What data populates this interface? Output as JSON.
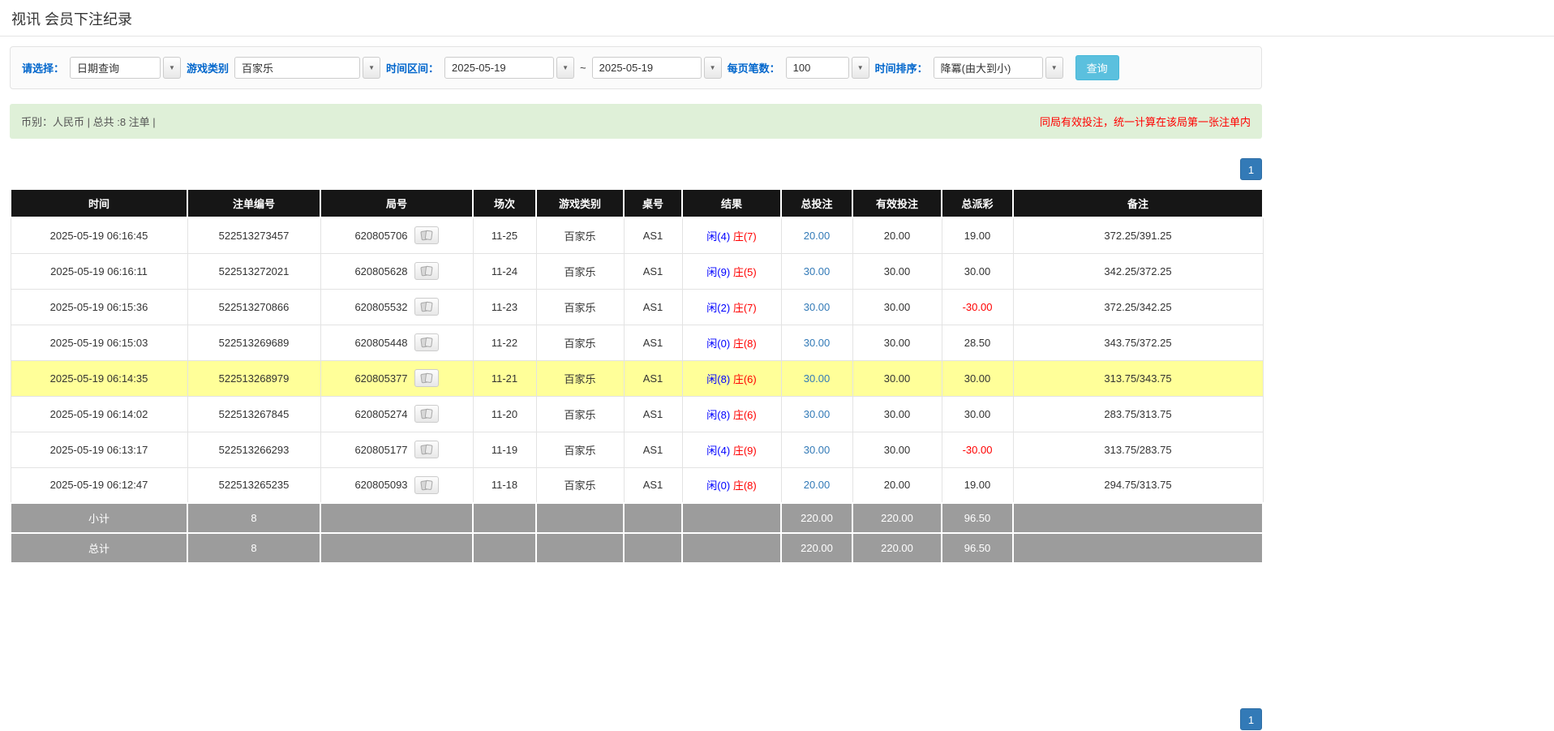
{
  "page": {
    "title": "视讯 会员下注纪录"
  },
  "filters": {
    "select_label": "请选择：",
    "select_value": "日期查询",
    "game_label": "游戏类别",
    "game_value": "百家乐",
    "range_label": "时间区间：",
    "range_from": "2025-05-19",
    "range_tilde": "~",
    "range_to": "2025-05-19",
    "per_page_label": "每页笔数：",
    "per_page_value": "100",
    "sort_label": "时间排序：",
    "sort_value": "降冪(由大到小)",
    "search_button": "查询"
  },
  "info_bar": {
    "summary": "币别：人民币 | 总共 :8 注单 |",
    "notice": "同局有效投注，统一计算在该局第一张注单内"
  },
  "pagination": {
    "page": "1"
  },
  "table": {
    "headers": [
      "时间",
      "注单编号",
      "局号",
      "场次",
      "游戏类别",
      "桌号",
      "结果",
      "总投注",
      "有效投注",
      "总派彩",
      "备注"
    ],
    "rows": [
      {
        "time": "2025-05-19 06:16:45",
        "bet_id": "522513273457",
        "round_id": "620805706",
        "session": "11-25",
        "game": "百家乐",
        "table_no": "AS1",
        "result_player": "闲(4)",
        "result_banker": "庄(7)",
        "total_bet": "20.00",
        "valid_bet": "20.00",
        "payout": "19.00",
        "payout_negative": false,
        "remark": "372.25/391.25",
        "highlighted": false
      },
      {
        "time": "2025-05-19 06:16:11",
        "bet_id": "522513272021",
        "round_id": "620805628",
        "session": "11-24",
        "game": "百家乐",
        "table_no": "AS1",
        "result_player": "闲(9)",
        "result_banker": "庄(5)",
        "total_bet": "30.00",
        "valid_bet": "30.00",
        "payout": "30.00",
        "payout_negative": false,
        "remark": "342.25/372.25",
        "highlighted": false
      },
      {
        "time": "2025-05-19 06:15:36",
        "bet_id": "522513270866",
        "round_id": "620805532",
        "session": "11-23",
        "game": "百家乐",
        "table_no": "AS1",
        "result_player": "闲(2)",
        "result_banker": "庄(7)",
        "total_bet": "30.00",
        "valid_bet": "30.00",
        "payout": "-30.00",
        "payout_negative": true,
        "remark": "372.25/342.25",
        "highlighted": false
      },
      {
        "time": "2025-05-19 06:15:03",
        "bet_id": "522513269689",
        "round_id": "620805448",
        "session": "11-22",
        "game": "百家乐",
        "table_no": "AS1",
        "result_player": "闲(0)",
        "result_banker": "庄(8)",
        "total_bet": "30.00",
        "valid_bet": "30.00",
        "payout": "28.50",
        "payout_negative": false,
        "remark": "343.75/372.25",
        "highlighted": false
      },
      {
        "time": "2025-05-19 06:14:35",
        "bet_id": "522513268979",
        "round_id": "620805377",
        "session": "11-21",
        "game": "百家乐",
        "table_no": "AS1",
        "result_player": "闲(8)",
        "result_banker": "庄(6)",
        "total_bet": "30.00",
        "valid_bet": "30.00",
        "payout": "30.00",
        "payout_negative": false,
        "remark": "313.75/343.75",
        "highlighted": true
      },
      {
        "time": "2025-05-19 06:14:02",
        "bet_id": "522513267845",
        "round_id": "620805274",
        "session": "11-20",
        "game": "百家乐",
        "table_no": "AS1",
        "result_player": "闲(8)",
        "result_banker": "庄(6)",
        "total_bet": "30.00",
        "valid_bet": "30.00",
        "payout": "30.00",
        "payout_negative": false,
        "remark": "283.75/313.75",
        "highlighted": false
      },
      {
        "time": "2025-05-19 06:13:17",
        "bet_id": "522513266293",
        "round_id": "620805177",
        "session": "11-19",
        "game": "百家乐",
        "table_no": "AS1",
        "result_player": "闲(4)",
        "result_banker": "庄(9)",
        "total_bet": "30.00",
        "valid_bet": "30.00",
        "payout": "-30.00",
        "payout_negative": true,
        "remark": "313.75/283.75",
        "highlighted": false
      },
      {
        "time": "2025-05-19 06:12:47",
        "bet_id": "522513265235",
        "round_id": "620805093",
        "session": "11-18",
        "game": "百家乐",
        "table_no": "AS1",
        "result_player": "闲(0)",
        "result_banker": "庄(8)",
        "total_bet": "20.00",
        "valid_bet": "20.00",
        "payout": "19.00",
        "payout_negative": false,
        "remark": "294.75/313.75",
        "highlighted": false
      }
    ],
    "footer_rows": [
      {
        "label": "小计",
        "count": "8",
        "total_bet": "220.00",
        "valid_bet": "220.00",
        "payout": "96.50"
      },
      {
        "label": "总计",
        "count": "8",
        "total_bet": "220.00",
        "valid_bet": "220.00",
        "payout": "96.50"
      }
    ]
  },
  "colors": {
    "accent_blue": "#0066cc",
    "link_blue": "#337ab7",
    "player_blue": "#0000ff",
    "banker_red": "#ff0000",
    "highlight_yellow": "#ffff99",
    "info_bg_green": "#dff0d8",
    "table_header_bg": "#161616",
    "summary_row_bg": "#9c9c9c",
    "search_button_bg": "#5bc0de",
    "page_button_bg": "#337ab7"
  }
}
